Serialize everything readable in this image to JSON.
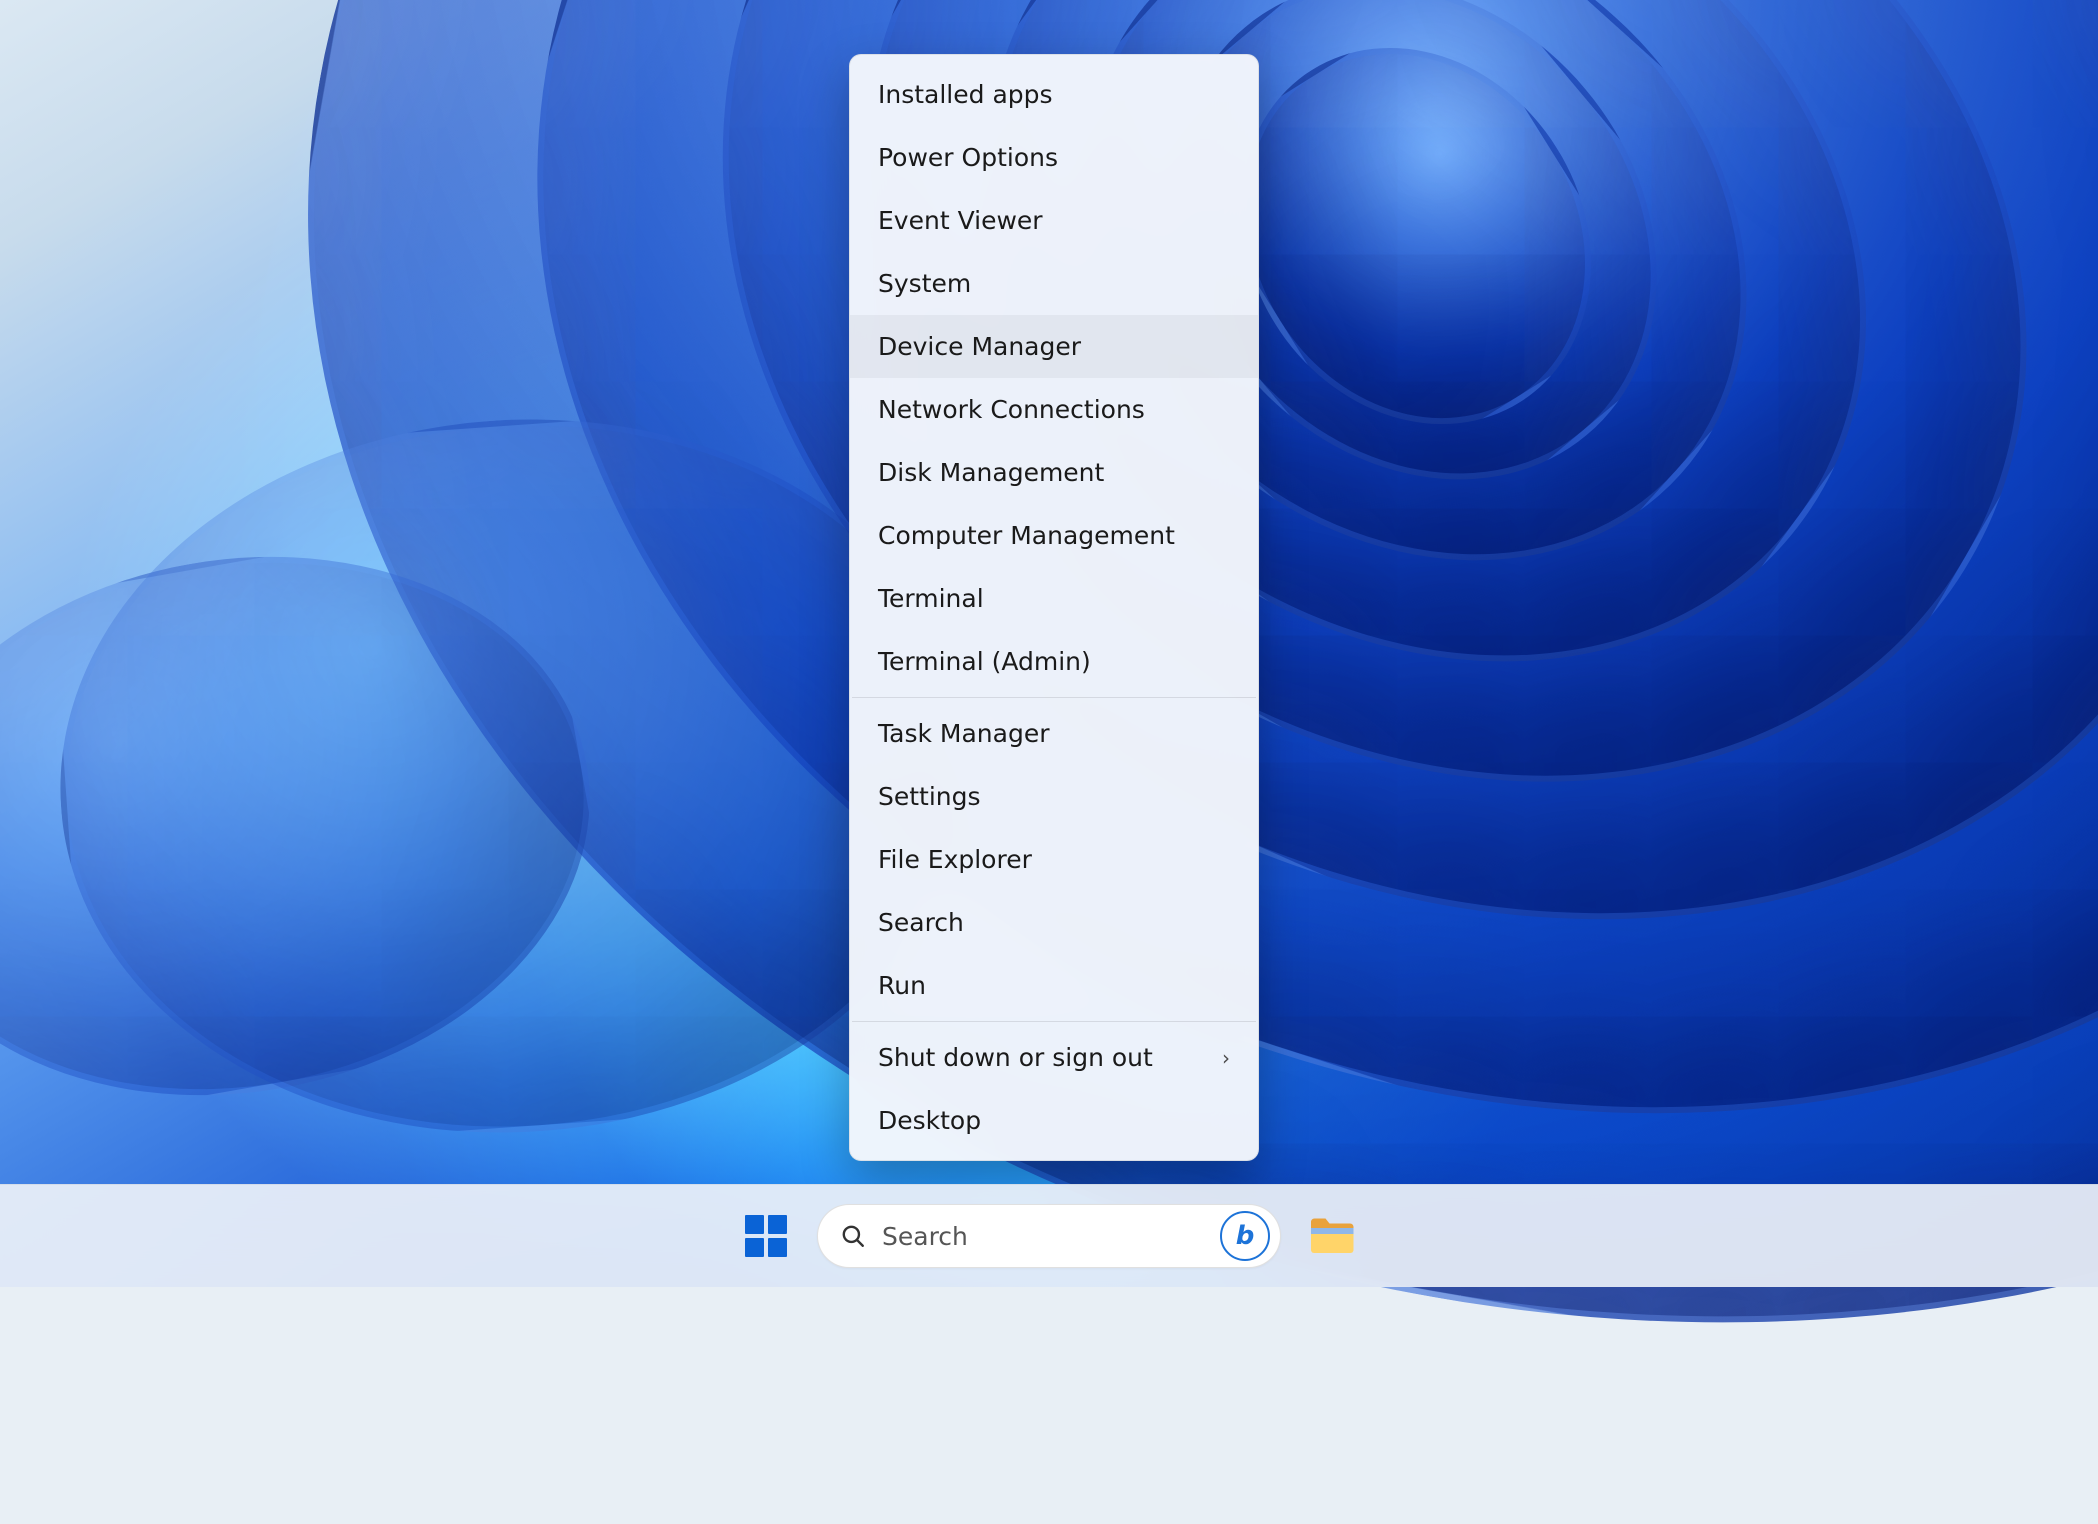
{
  "context_menu": {
    "groups": [
      [
        {
          "label": "Installed apps",
          "submenu": false,
          "hover": false
        },
        {
          "label": "Power Options",
          "submenu": false,
          "hover": false
        },
        {
          "label": "Event Viewer",
          "submenu": false,
          "hover": false
        },
        {
          "label": "System",
          "submenu": false,
          "hover": false
        },
        {
          "label": "Device Manager",
          "submenu": false,
          "hover": true
        },
        {
          "label": "Network Connections",
          "submenu": false,
          "hover": false
        },
        {
          "label": "Disk Management",
          "submenu": false,
          "hover": false
        },
        {
          "label": "Computer Management",
          "submenu": false,
          "hover": false
        },
        {
          "label": "Terminal",
          "submenu": false,
          "hover": false
        },
        {
          "label": "Terminal (Admin)",
          "submenu": false,
          "hover": false
        }
      ],
      [
        {
          "label": "Task Manager",
          "submenu": false,
          "hover": false
        },
        {
          "label": "Settings",
          "submenu": false,
          "hover": false
        },
        {
          "label": "File Explorer",
          "submenu": false,
          "hover": false
        },
        {
          "label": "Search",
          "submenu": false,
          "hover": false
        },
        {
          "label": "Run",
          "submenu": false,
          "hover": false
        }
      ],
      [
        {
          "label": "Shut down or sign out",
          "submenu": true,
          "hover": false
        },
        {
          "label": "Desktop",
          "submenu": false,
          "hover": false
        }
      ]
    ]
  },
  "taskbar": {
    "search_placeholder": "Search",
    "bing_glyph": "b"
  }
}
